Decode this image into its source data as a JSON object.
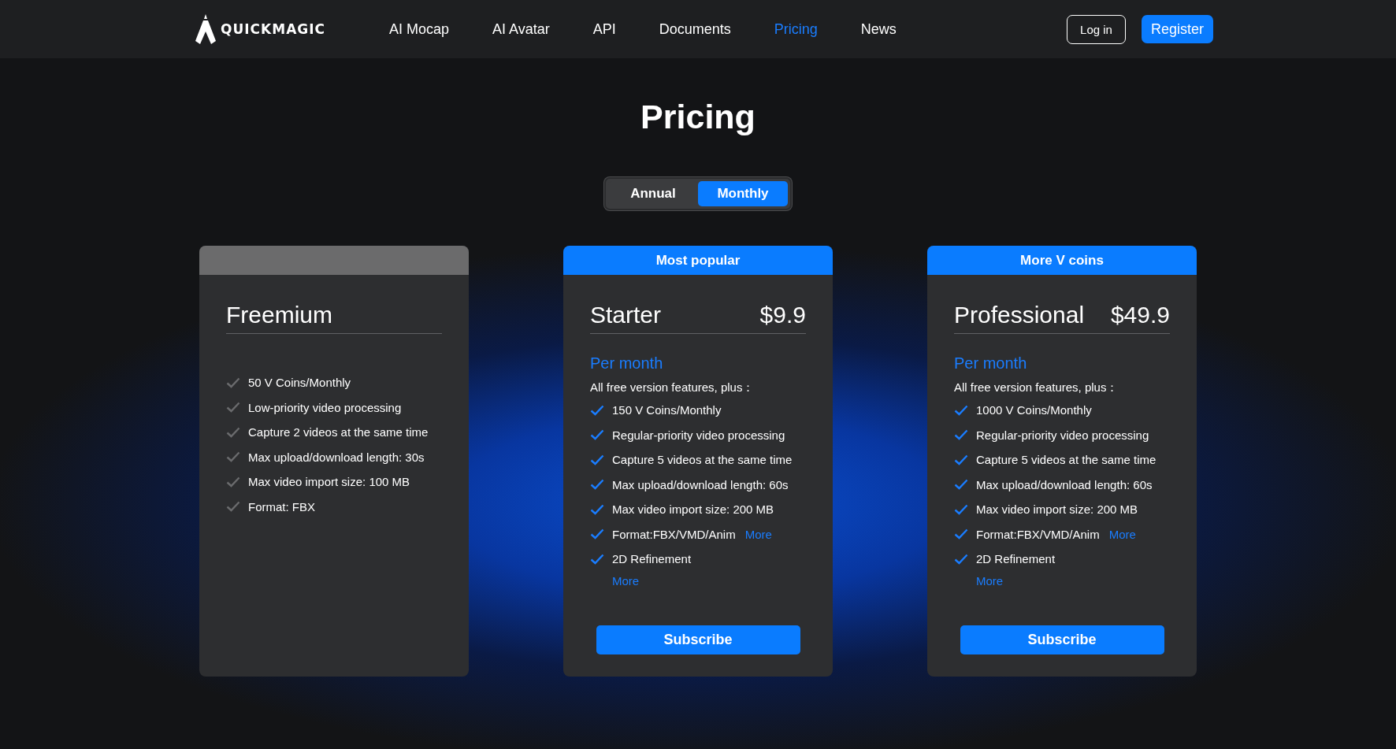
{
  "header": {
    "logo": "QUICKMAGIC",
    "nav": [
      {
        "label": "AI Mocap",
        "selected": false
      },
      {
        "label": "AI Avatar",
        "selected": false
      },
      {
        "label": "API",
        "selected": false
      },
      {
        "label": "Documents",
        "selected": false
      },
      {
        "label": "Pricing",
        "selected": true
      },
      {
        "label": "News",
        "selected": false
      }
    ],
    "login": "Log in",
    "register": "Register"
  },
  "title": "Pricing",
  "billing_toggle": [
    {
      "label": "Annual",
      "selected": false
    },
    {
      "label": "Monthly",
      "selected": true
    }
  ],
  "plans": [
    {
      "featured": false,
      "name": "Freemium",
      "features": [
        {
          "text": "50 V Coins/Monthly"
        },
        {
          "text": "Low-priority video processing"
        },
        {
          "text": "Capture 2 videos at the same time"
        },
        {
          "text": "Max upload/download length: 30s"
        },
        {
          "text": "Max video import size: 100 MB"
        },
        {
          "text": "Format: FBX"
        }
      ]
    },
    {
      "featured": true,
      "banner": "Most popular",
      "name": "Starter",
      "price": "$9.9",
      "period": "Per month",
      "intro": "All free version features, plus：",
      "features": [
        {
          "text": "150 V Coins/Monthly"
        },
        {
          "text": "Regular-priority video processing"
        },
        {
          "text": "Capture 5 videos at the same time"
        },
        {
          "text": "Max upload/download length: 60s"
        },
        {
          "text": "Max video import size: 200 MB"
        },
        {
          "text": "Format:FBX/VMD/Anim",
          "link": "More"
        },
        {
          "text": "2D Refinement"
        }
      ],
      "more": "More",
      "button": "Subscribe"
    },
    {
      "featured": true,
      "banner": "More V coins",
      "name": "Professional",
      "price": "$49.9",
      "period": "Per month",
      "intro": "All free version features, plus：",
      "features": [
        {
          "text": "1000 V Coins/Monthly"
        },
        {
          "text": "Regular-priority video processing"
        },
        {
          "text": "Capture 5 videos at the same time"
        },
        {
          "text": "Max upload/download length: 60s"
        },
        {
          "text": "Max video import size: 200 MB"
        },
        {
          "text": "Format:FBX/VMD/Anim",
          "link": "More"
        },
        {
          "text": "2D Refinement"
        }
      ],
      "more": "More",
      "button": "Subscribe"
    }
  ]
}
